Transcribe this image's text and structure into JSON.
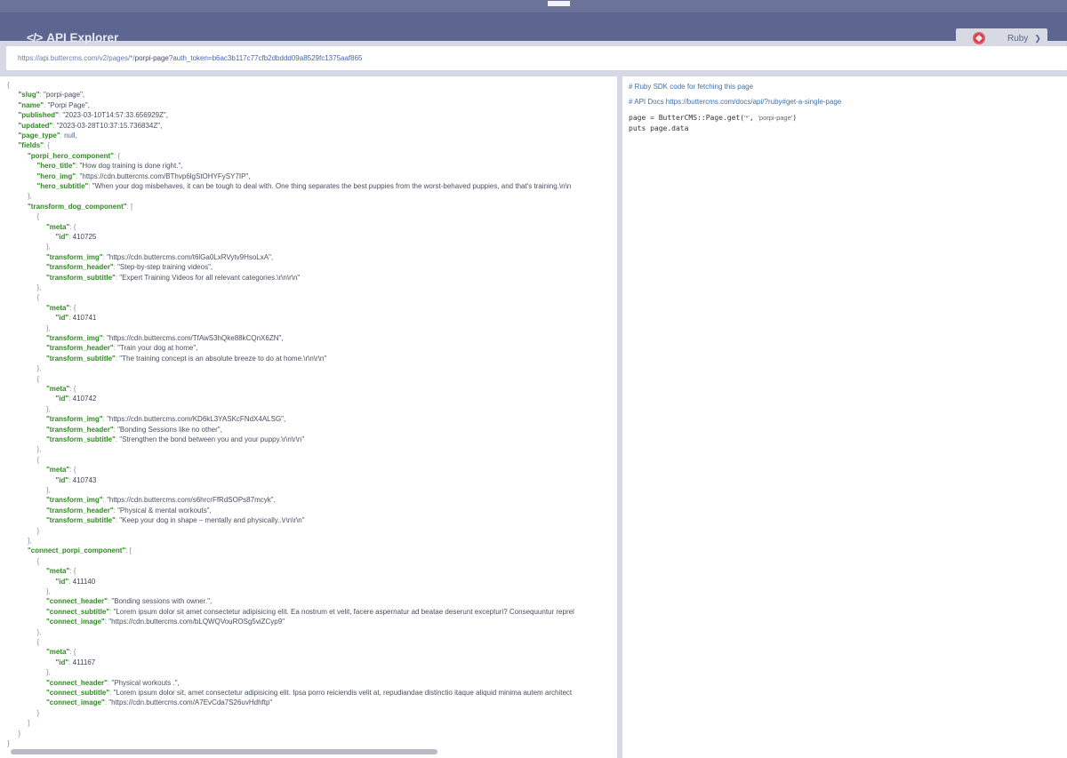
{
  "header": {
    "title": "API Explorer",
    "language": "Ruby"
  },
  "url": {
    "base": "https://api.buttercms.com/v2/pages/*/",
    "slug": "porpi-page",
    "query": "?auth_token=b6ac3b117c77cfb2dbddd09a8529fc1375aaf865"
  },
  "json_lines": [
    {
      "indent": 0,
      "parts": [
        [
          "p",
          "{"
        ]
      ]
    },
    {
      "indent": 1,
      "parts": [
        [
          "k",
          "\"slug\""
        ],
        [
          "p",
          ":  "
        ],
        [
          "s",
          "\"porpi-page\","
        ]
      ]
    },
    {
      "indent": 1,
      "parts": [
        [
          "k",
          "\"name\""
        ],
        [
          "p",
          ":  "
        ],
        [
          "s",
          "\"Porpi Page\","
        ]
      ]
    },
    {
      "indent": 1,
      "parts": [
        [
          "k",
          "\"published\""
        ],
        [
          "p",
          ":  "
        ],
        [
          "s",
          "\"2023-03-10T14:57:33.656929Z\","
        ]
      ]
    },
    {
      "indent": 1,
      "parts": [
        [
          "k",
          "\"updated\""
        ],
        [
          "p",
          ":  "
        ],
        [
          "s",
          "\"2023-03-28T10:37:15.736834Z\","
        ]
      ]
    },
    {
      "indent": 1,
      "parts": [
        [
          "k",
          "\"page_type\""
        ],
        [
          "p",
          ":  "
        ],
        [
          "nul",
          "null,"
        ]
      ]
    },
    {
      "indent": 1,
      "parts": [
        [
          "k",
          "\"fields\""
        ],
        [
          "p",
          ":  {"
        ]
      ]
    },
    {
      "indent": 2,
      "parts": [
        [
          "k",
          "\"porpi_hero_component\""
        ],
        [
          "p",
          ":  {"
        ]
      ]
    },
    {
      "indent": 3,
      "parts": [
        [
          "k",
          "\"hero_title\""
        ],
        [
          "p",
          ":  "
        ],
        [
          "s",
          "\"How dog training is done right.\","
        ]
      ]
    },
    {
      "indent": 3,
      "parts": [
        [
          "k",
          "\"hero_img\""
        ],
        [
          "p",
          ":  "
        ],
        [
          "s",
          "\"https://cdn.buttercms.com/BThvp6lgStOHYFySY7IP\","
        ]
      ]
    },
    {
      "indent": 3,
      "parts": [
        [
          "k",
          "\"hero_subtitle\""
        ],
        [
          "p",
          ":  "
        ],
        [
          "s",
          "\"When your dog misbehaves, it can be tough to deal with. One thing separates the best puppies from the worst-behaved puppies, and that's training.\\n\\n"
        ]
      ]
    },
    {
      "indent": 2,
      "parts": [
        [
          "p",
          "},"
        ]
      ]
    },
    {
      "indent": 2,
      "parts": [
        [
          "k",
          "\"transform_dog_component\""
        ],
        [
          "p",
          ":  ["
        ]
      ]
    },
    {
      "indent": 3,
      "parts": [
        [
          "p",
          "{"
        ]
      ]
    },
    {
      "indent": 4,
      "parts": [
        [
          "k",
          "\"meta\""
        ],
        [
          "p",
          ":  {"
        ]
      ]
    },
    {
      "indent": 5,
      "parts": [
        [
          "k",
          "\"id\""
        ],
        [
          "p",
          ":  "
        ],
        [
          "n",
          "410725"
        ]
      ]
    },
    {
      "indent": 4,
      "parts": [
        [
          "p",
          "},"
        ]
      ]
    },
    {
      "indent": 4,
      "parts": [
        [
          "k",
          "\"transform_img\""
        ],
        [
          "p",
          ":  "
        ],
        [
          "s",
          "\"https://cdn.buttercms.com/t6lGa0LxRVytv9HsoLxA\","
        ]
      ]
    },
    {
      "indent": 4,
      "parts": [
        [
          "k",
          "\"transform_header\""
        ],
        [
          "p",
          ":  "
        ],
        [
          "s",
          "\"Step-by-step training videos\","
        ]
      ]
    },
    {
      "indent": 4,
      "parts": [
        [
          "k",
          "\"transform_subtitle\""
        ],
        [
          "p",
          ":  "
        ],
        [
          "s",
          "\"Expert Training Videos for all relevant categories.\\r\\n\\r\\n\""
        ]
      ]
    },
    {
      "indent": 3,
      "parts": [
        [
          "p",
          "},"
        ]
      ]
    },
    {
      "indent": 3,
      "parts": [
        [
          "p",
          "{"
        ]
      ]
    },
    {
      "indent": 4,
      "parts": [
        [
          "k",
          "\"meta\""
        ],
        [
          "p",
          ":  {"
        ]
      ]
    },
    {
      "indent": 5,
      "parts": [
        [
          "k",
          "\"id\""
        ],
        [
          "p",
          ":  "
        ],
        [
          "n",
          "410741"
        ]
      ]
    },
    {
      "indent": 4,
      "parts": [
        [
          "p",
          "},"
        ]
      ]
    },
    {
      "indent": 4,
      "parts": [
        [
          "k",
          "\"transform_img\""
        ],
        [
          "p",
          ":  "
        ],
        [
          "s",
          "\"https://cdn.buttercms.com/TfAwS3hQke88kCQnX6ZN\","
        ]
      ]
    },
    {
      "indent": 4,
      "parts": [
        [
          "k",
          "\"transform_header\""
        ],
        [
          "p",
          ":  "
        ],
        [
          "s",
          "\"Train your dog at home\","
        ]
      ]
    },
    {
      "indent": 4,
      "parts": [
        [
          "k",
          "\"transform_subtitle\""
        ],
        [
          "p",
          ":  "
        ],
        [
          "s",
          "\"The training concept is an absolute breeze to do at home.\\r\\n\\r\\n\""
        ]
      ]
    },
    {
      "indent": 3,
      "parts": [
        [
          "p",
          "},"
        ]
      ]
    },
    {
      "indent": 3,
      "parts": [
        [
          "p",
          "{"
        ]
      ]
    },
    {
      "indent": 4,
      "parts": [
        [
          "k",
          "\"meta\""
        ],
        [
          "p",
          ":  {"
        ]
      ]
    },
    {
      "indent": 5,
      "parts": [
        [
          "k",
          "\"id\""
        ],
        [
          "p",
          ":  "
        ],
        [
          "n",
          "410742"
        ]
      ]
    },
    {
      "indent": 4,
      "parts": [
        [
          "p",
          "},"
        ]
      ]
    },
    {
      "indent": 4,
      "parts": [
        [
          "k",
          "\"transform_img\""
        ],
        [
          "p",
          ":  "
        ],
        [
          "s",
          "\"https://cdn.buttercms.com/KD6kL3YASKcFNdX4ALSG\","
        ]
      ]
    },
    {
      "indent": 4,
      "parts": [
        [
          "k",
          "\"transform_header\""
        ],
        [
          "p",
          ":  "
        ],
        [
          "s",
          "\"Bonding Sessions like no other\","
        ]
      ]
    },
    {
      "indent": 4,
      "parts": [
        [
          "k",
          "\"transform_subtitle\""
        ],
        [
          "p",
          ":  "
        ],
        [
          "s",
          "\"Strengthen the bond between you and your puppy.\\r\\n\\r\\n\""
        ]
      ]
    },
    {
      "indent": 3,
      "parts": [
        [
          "p",
          "},"
        ]
      ]
    },
    {
      "indent": 3,
      "parts": [
        [
          "p",
          "{"
        ]
      ]
    },
    {
      "indent": 4,
      "parts": [
        [
          "k",
          "\"meta\""
        ],
        [
          "p",
          ":  {"
        ]
      ]
    },
    {
      "indent": 5,
      "parts": [
        [
          "k",
          "\"id\""
        ],
        [
          "p",
          ":  "
        ],
        [
          "n",
          "410743"
        ]
      ]
    },
    {
      "indent": 4,
      "parts": [
        [
          "p",
          "},"
        ]
      ]
    },
    {
      "indent": 4,
      "parts": [
        [
          "k",
          "\"transform_img\""
        ],
        [
          "p",
          ":  "
        ],
        [
          "s",
          "\"https://cdn.buttercms.com/s6hrcrFfRdSOPs87mcyk\","
        ]
      ]
    },
    {
      "indent": 4,
      "parts": [
        [
          "k",
          "\"transform_header\""
        ],
        [
          "p",
          ":  "
        ],
        [
          "s",
          "\"Physical & mental workouts\","
        ]
      ]
    },
    {
      "indent": 4,
      "parts": [
        [
          "k",
          "\"transform_subtitle\""
        ],
        [
          "p",
          ":  "
        ],
        [
          "s",
          "\"Keep your dog in shape – mentally and physically..\\r\\n\\r\\n\""
        ]
      ]
    },
    {
      "indent": 3,
      "parts": [
        [
          "p",
          "}"
        ]
      ]
    },
    {
      "indent": 2,
      "parts": [
        [
          "p",
          "],"
        ]
      ]
    },
    {
      "indent": 2,
      "parts": [
        [
          "k",
          "\"connect_porpi_component\""
        ],
        [
          "p",
          ":  ["
        ]
      ]
    },
    {
      "indent": 3,
      "parts": [
        [
          "p",
          "{"
        ]
      ]
    },
    {
      "indent": 4,
      "parts": [
        [
          "k",
          "\"meta\""
        ],
        [
          "p",
          ":  {"
        ]
      ]
    },
    {
      "indent": 5,
      "parts": [
        [
          "k",
          "\"id\""
        ],
        [
          "p",
          ":  "
        ],
        [
          "n",
          "411140"
        ]
      ]
    },
    {
      "indent": 4,
      "parts": [
        [
          "p",
          "},"
        ]
      ]
    },
    {
      "indent": 4,
      "parts": [
        [
          "k",
          "\"connect_header\""
        ],
        [
          "p",
          ":  "
        ],
        [
          "s",
          "\"Bonding sessions with owner.\","
        ]
      ]
    },
    {
      "indent": 4,
      "parts": [
        [
          "k",
          "\"connect_subtitle\""
        ],
        [
          "p",
          ":  "
        ],
        [
          "s",
          "\"Lorem ipsum dolor sit amet consectetur adipisicing elit. Ea nostrum et velit, facere aspernatur ad beatae deserunt excepturi? Consequuntur reprel"
        ]
      ]
    },
    {
      "indent": 4,
      "parts": [
        [
          "k",
          "\"connect_image\""
        ],
        [
          "p",
          ":  "
        ],
        [
          "s",
          "\"https://cdn.buttercms.com/bLQWQVouROSg5viZCyp9\""
        ]
      ]
    },
    {
      "indent": 3,
      "parts": [
        [
          "p",
          "},"
        ]
      ]
    },
    {
      "indent": 3,
      "parts": [
        [
          "p",
          "{"
        ]
      ]
    },
    {
      "indent": 4,
      "parts": [
        [
          "k",
          "\"meta\""
        ],
        [
          "p",
          ":  {"
        ]
      ]
    },
    {
      "indent": 5,
      "parts": [
        [
          "k",
          "\"id\""
        ],
        [
          "p",
          ":  "
        ],
        [
          "n",
          "411167"
        ]
      ]
    },
    {
      "indent": 4,
      "parts": [
        [
          "p",
          "},"
        ]
      ]
    },
    {
      "indent": 4,
      "parts": [
        [
          "k",
          "\"connect_header\""
        ],
        [
          "p",
          ":  "
        ],
        [
          "s",
          "\"Physical workouts .\","
        ]
      ]
    },
    {
      "indent": 4,
      "parts": [
        [
          "k",
          "\"connect_subtitle\""
        ],
        [
          "p",
          ":  "
        ],
        [
          "s",
          "\"Lorem ipsum dolor sit, amet consectetur adipisicing elit. Ipsa porro reiciendis velit at, repudiandae distinctio itaque aliquid minima autem architect"
        ]
      ]
    },
    {
      "indent": 4,
      "parts": [
        [
          "k",
          "\"connect_image\""
        ],
        [
          "p",
          ":  "
        ],
        [
          "s",
          "\"https://cdn.buttercms.com/A7EvCda7S26uvHdhftp\""
        ]
      ]
    },
    {
      "indent": 3,
      "parts": [
        [
          "p",
          "}"
        ]
      ]
    },
    {
      "indent": 2,
      "parts": [
        [
          "p",
          "]"
        ]
      ]
    },
    {
      "indent": 1,
      "parts": [
        [
          "p",
          "}"
        ]
      ]
    },
    {
      "indent": 0,
      "parts": [
        [
          "p",
          "}"
        ]
      ]
    }
  ],
  "code": {
    "comment1": "# Ruby SDK code for fetching this page",
    "comment2": "# API Docs https://buttercms.com/docs/api/?ruby#get-a-single-page",
    "line1_code": "page = ButterCMS::Page.get(",
    "line1_arg1": "'*'",
    "line1_sep": ",  ",
    "line1_arg2": "'porpi-page'",
    "line1_close": ")",
    "line2": "puts page.data"
  }
}
